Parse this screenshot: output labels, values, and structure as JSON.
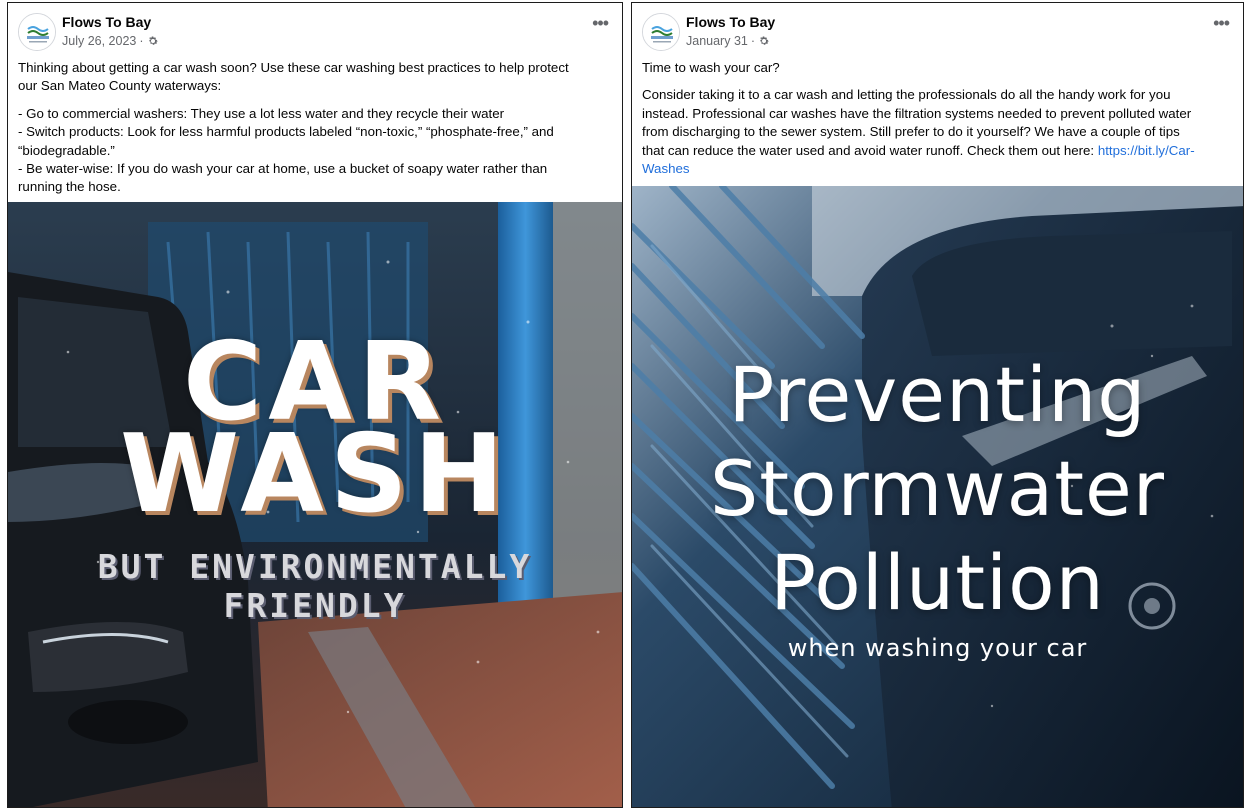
{
  "posts": [
    {
      "page_name": "Flows To Bay",
      "date": "July 26, 2023",
      "audience_icon": "gear-icon",
      "more_icon": "ellipsis-icon",
      "more_label": "•••",
      "caption_lines": [
        "Thinking about getting a car wash soon? Use these car washing best practices to help protect",
        "our San Mateo County waterways:",
        "- Go to commercial washers: They use a lot less water and they recycle their water",
        "- Switch products: Look for less harmful products labeled “non-toxic,” “phosphate-free,” and",
        "“biodegradable.”",
        "- Be water-wise: If you do wash your car at home, use a bucket of soapy water rather than",
        "running the hose."
      ],
      "image": {
        "title_line1": "CAR",
        "title_line2": "WASH",
        "subtitle_line1": "BUT ENVIRONMENTALLY",
        "subtitle_line2": "FRIENDLY"
      }
    },
    {
      "page_name": "Flows To Bay",
      "date": "January 31",
      "audience_icon": "gear-icon",
      "more_icon": "ellipsis-icon",
      "more_label": "•••",
      "caption_first": "Time to wash your car?",
      "caption_lines": [
        "Consider taking it to a car wash and letting the professionals do all the handy work for you",
        "instead. Professional car washes have the filtration systems needed to prevent polluted water",
        "from discharging to the sewer system. Still prefer to do it yourself? We have a couple of tips",
        "that can reduce the water used and avoid water runoff. Check them out here: "
      ],
      "link_part1": "https://bit.ly/Car-",
      "link_part2": "Washes",
      "image": {
        "title_line1": "Preventing",
        "title_line2": "Stormwater",
        "title_line3": "Pollution",
        "subtitle": "when washing your car"
      }
    }
  ],
  "colors": {
    "link": "#216fdb",
    "meta_text": "#65676b",
    "border": "#1c1c1c"
  }
}
